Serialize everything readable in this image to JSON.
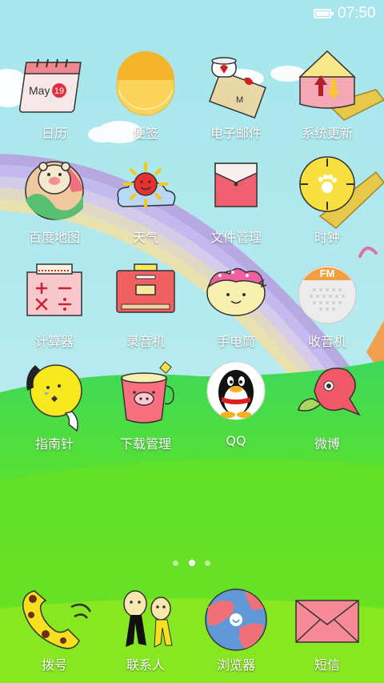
{
  "status_bar": {
    "time": "07:50",
    "battery_level": 1.0
  },
  "apps": [
    {
      "label": "日历",
      "calendar_month": "May",
      "calendar_day": "19"
    },
    {
      "label": "便签"
    },
    {
      "label": "电子邮件",
      "envelope_letter": "M"
    },
    {
      "label": "系统更新"
    },
    {
      "label": "百度地图"
    },
    {
      "label": "天气"
    },
    {
      "label": "文件管理"
    },
    {
      "label": "时钟"
    },
    {
      "label": "计算器"
    },
    {
      "label": "录音机"
    },
    {
      "label": "手电筒"
    },
    {
      "label": "收音机",
      "radio_badge": "FM"
    },
    {
      "label": "指南针"
    },
    {
      "label": "下载管理"
    },
    {
      "label": "QQ"
    },
    {
      "label": "微博"
    }
  ],
  "pager": {
    "count": 3,
    "active": 1
  },
  "dock": [
    {
      "label": "拨号"
    },
    {
      "label": "联系人"
    },
    {
      "label": "浏览器"
    },
    {
      "label": "短信"
    }
  ],
  "colors": {
    "sky": "#9fe0e8",
    "grass": "#5fe030",
    "label_text": "#ffffff"
  }
}
